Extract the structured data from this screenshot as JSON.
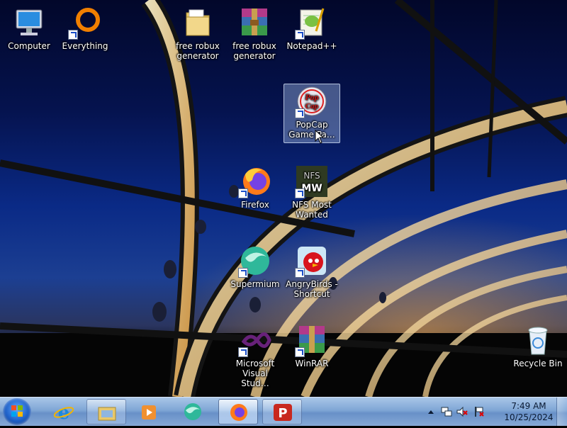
{
  "desktop": {
    "icons": [
      {
        "label": "Computer",
        "icon": "computer-icon"
      },
      {
        "label": "Everything",
        "icon": "everything-icon"
      },
      {
        "label": "free robux generator",
        "icon": "folder-icon"
      },
      {
        "label": "free robux generator",
        "icon": "winrar-archive-icon"
      },
      {
        "label": "Notepad++",
        "icon": "notepad-plus-plus-icon"
      },
      {
        "label": "PopCap Game Pa…",
        "icon": "popcap-icon",
        "selected": true
      },
      {
        "label": "Firefox",
        "icon": "firefox-icon"
      },
      {
        "label": "NFS Most Wanted",
        "icon": "nfs-most-wanted-icon"
      },
      {
        "label": "Supermium",
        "icon": "supermium-icon"
      },
      {
        "label": "AngryBirds - Shortcut",
        "icon": "angry-birds-icon"
      },
      {
        "label": "Microsoft Visual Stud…",
        "icon": "visual-studio-icon"
      },
      {
        "label": "WinRAR",
        "icon": "winrar-icon"
      },
      {
        "label": "Recycle Bin",
        "icon": "recycle-bin-icon"
      }
    ],
    "nfs_logo_text": "NFS MW",
    "popcap_logo_text": "Pop Cap"
  },
  "taskbar": {
    "start": {
      "icon": "windows-start-icon"
    },
    "buttons": [
      {
        "name": "Internet Explorer",
        "icon": "internet-explorer-icon",
        "state": "pinned"
      },
      {
        "name": "File Explorer",
        "icon": "file-explorer-icon",
        "state": "running"
      },
      {
        "name": "Media Player",
        "icon": "media-player-icon",
        "state": "pinned"
      },
      {
        "name": "Supermium",
        "icon": "supermium-icon",
        "state": "pinned"
      },
      {
        "name": "Firefox",
        "icon": "firefox-icon",
        "state": "active"
      },
      {
        "name": "Psiphon",
        "icon": "psiphon-icon",
        "state": "running"
      }
    ],
    "tray": {
      "icons": [
        "show-hidden-icons-chevron",
        "network-icon",
        "volume-muted-icon",
        "action-center-flag-icon"
      ],
      "time": "7:49 AM",
      "date": "10/25/2024"
    }
  },
  "colors": {
    "taskbar": "#7fa6d5",
    "sky_top": "#02072a",
    "sky_mid": "#0a2a86",
    "glow": "#ffaf46"
  }
}
